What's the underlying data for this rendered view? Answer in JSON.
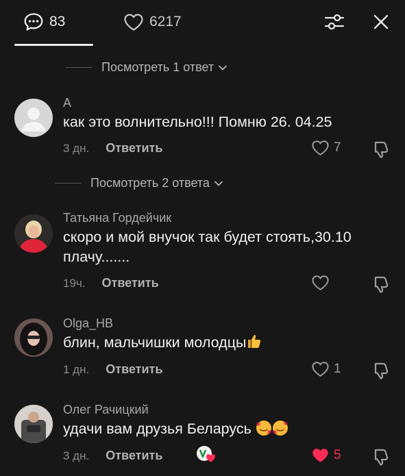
{
  "header": {
    "comments_count": "83",
    "likes_count": "6217",
    "icons": {
      "comments": "speech-bubble-icon",
      "likes": "heart-outline-icon",
      "filter": "sliders-icon",
      "close": "close-icon"
    }
  },
  "threads": [
    {
      "replies_label": "Посмотреть 1 ответ"
    },
    {
      "replies_label": "Посмотреть 2 ответа"
    }
  ],
  "comments": [
    {
      "author": "A",
      "text": "как это волнительно!!! Помню 26. 04.25",
      "time": "3 дн.",
      "reply_label": "Ответить",
      "likes": "7",
      "liked": false,
      "avatar": "default-avatar-icon"
    },
    {
      "author": "Татьяна Гордейчик",
      "text": "скоро и мой внучок так будет стоять,30.10 плачу.......",
      "time": "19ч.",
      "reply_label": "Ответить",
      "likes": "",
      "liked": false,
      "avatar": "user-photo-red"
    },
    {
      "author": "Olga_HB",
      "text": "блин, мальчишки молодцы",
      "text_emoji": "thumbs-up-emoji",
      "time": "1 дн.",
      "reply_label": "Ответить",
      "likes": "1",
      "liked": false,
      "avatar": "user-photo-dark"
    },
    {
      "author": "Олег Рачицкий",
      "text": "удачи вам друзья Беларусь",
      "text_emoji": "smiling-face-with-hearts-emoji",
      "time": "3 дн.",
      "reply_label": "Ответить",
      "likes": "5",
      "liked": true,
      "avatar": "user-photo-light",
      "creator_badge": "creator-liked-badge"
    }
  ],
  "colors": {
    "background": "#171717",
    "liked": "#fe2c55",
    "muted": "#8a8a8a"
  }
}
